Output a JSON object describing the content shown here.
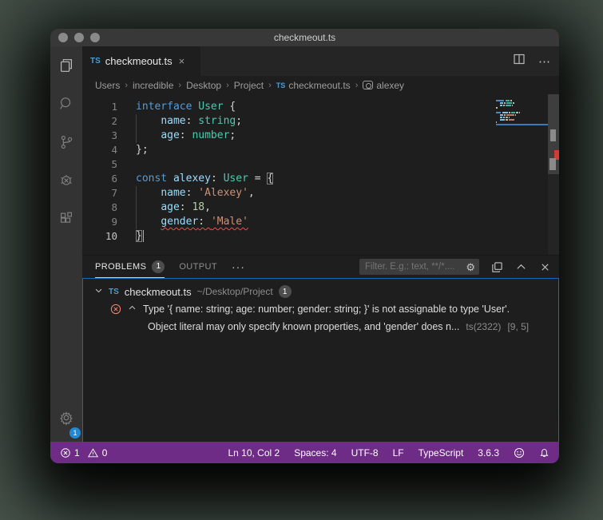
{
  "window": {
    "title": "checkmeout.ts"
  },
  "colors": {
    "accent": "#1668b8",
    "statusbar": "#6f2c87",
    "error": "#f48771",
    "squiggle": "#f14c4c",
    "keyword": "#569cd6",
    "type": "#4ec9b0",
    "variable": "#9cdcfe",
    "string": "#ce9178",
    "number": "#b5cea8"
  },
  "activity_bar": {
    "items": [
      "explorer",
      "search",
      "source-control",
      "debug",
      "extensions"
    ],
    "settings_badge": "1"
  },
  "tab_bar": {
    "tab_icon": "TS",
    "tab_label": "checkmeout.ts",
    "close": "×"
  },
  "breadcrumbs": {
    "items": [
      {
        "label": "Users"
      },
      {
        "label": "incredible"
      },
      {
        "label": "Desktop"
      },
      {
        "label": "Project"
      },
      {
        "label": "checkmeout.ts",
        "icon": "ts"
      },
      {
        "label": "alexey",
        "icon": "symbol-variable"
      }
    ]
  },
  "editor": {
    "lines": [
      {
        "n": "1",
        "tokens": [
          {
            "c": "kw",
            "t": "interface"
          },
          {
            "c": "pun",
            "t": " "
          },
          {
            "c": "type",
            "t": "User"
          },
          {
            "c": "pun",
            "t": " {"
          }
        ]
      },
      {
        "n": "2",
        "guide": true,
        "tokens": [
          {
            "c": "pun",
            "t": "    "
          },
          {
            "c": "var",
            "t": "name"
          },
          {
            "c": "pun",
            "t": ": "
          },
          {
            "c": "type",
            "t": "string"
          },
          {
            "c": "pun",
            "t": ";"
          }
        ]
      },
      {
        "n": "3",
        "guide": true,
        "tokens": [
          {
            "c": "pun",
            "t": "    "
          },
          {
            "c": "var",
            "t": "age"
          },
          {
            "c": "pun",
            "t": ": "
          },
          {
            "c": "type",
            "t": "number"
          },
          {
            "c": "pun",
            "t": ";"
          }
        ]
      },
      {
        "n": "4",
        "tokens": [
          {
            "c": "pun",
            "t": "};"
          }
        ]
      },
      {
        "n": "5",
        "tokens": []
      },
      {
        "n": "6",
        "tokens": [
          {
            "c": "kw",
            "t": "const"
          },
          {
            "c": "pun",
            "t": " "
          },
          {
            "c": "var",
            "t": "alexey"
          },
          {
            "c": "pun",
            "t": ": "
          },
          {
            "c": "type",
            "t": "User"
          },
          {
            "c": "pun",
            "t": " = "
          },
          {
            "c": "pun",
            "t": "{",
            "b": true
          }
        ]
      },
      {
        "n": "7",
        "guide": true,
        "tokens": [
          {
            "c": "pun",
            "t": "    "
          },
          {
            "c": "var",
            "t": "name"
          },
          {
            "c": "pun",
            "t": ": "
          },
          {
            "c": "str",
            "t": "'Alexey'"
          },
          {
            "c": "pun",
            "t": ","
          }
        ]
      },
      {
        "n": "8",
        "guide": true,
        "tokens": [
          {
            "c": "pun",
            "t": "    "
          },
          {
            "c": "var",
            "t": "age"
          },
          {
            "c": "pun",
            "t": ": "
          },
          {
            "c": "num",
            "t": "18"
          },
          {
            "c": "pun",
            "t": ","
          }
        ]
      },
      {
        "n": "9",
        "guide": true,
        "tokens": [
          {
            "c": "pun",
            "t": "    "
          },
          {
            "c": "var",
            "t": "gender",
            "u": true
          },
          {
            "c": "pun",
            "t": ": ",
            "u": true
          },
          {
            "c": "str",
            "t": "'Male'",
            "u": true
          }
        ]
      },
      {
        "n": "10",
        "active": true,
        "cursor": true,
        "tokens": [
          {
            "c": "pun",
            "t": "}",
            "b": true
          }
        ]
      }
    ]
  },
  "panel": {
    "tabs": [
      {
        "label": "PROBLEMS",
        "badge": "1",
        "active": true
      },
      {
        "label": "OUTPUT"
      }
    ],
    "more_label": "···",
    "filter_placeholder": "Filter. E.g.: text, **/*....",
    "file_row": {
      "icon": "TS",
      "name": "checkmeout.ts",
      "path": "~/Desktop/Project",
      "badge": "1"
    },
    "error": {
      "message": "Type '{ name: string; age: number; gender: string; }' is not assignable to type 'User'.",
      "detail": "Object literal may only specify known properties, and 'gender' does n...",
      "source": "ts(2322)",
      "position": "[9, 5]"
    }
  },
  "status_bar": {
    "errors": "1",
    "warnings": "0",
    "cursor_position": "Ln 10, Col 2",
    "indentation": "Spaces: 4",
    "encoding": "UTF-8",
    "eol": "LF",
    "language": "TypeScript",
    "version": "3.6.3"
  }
}
